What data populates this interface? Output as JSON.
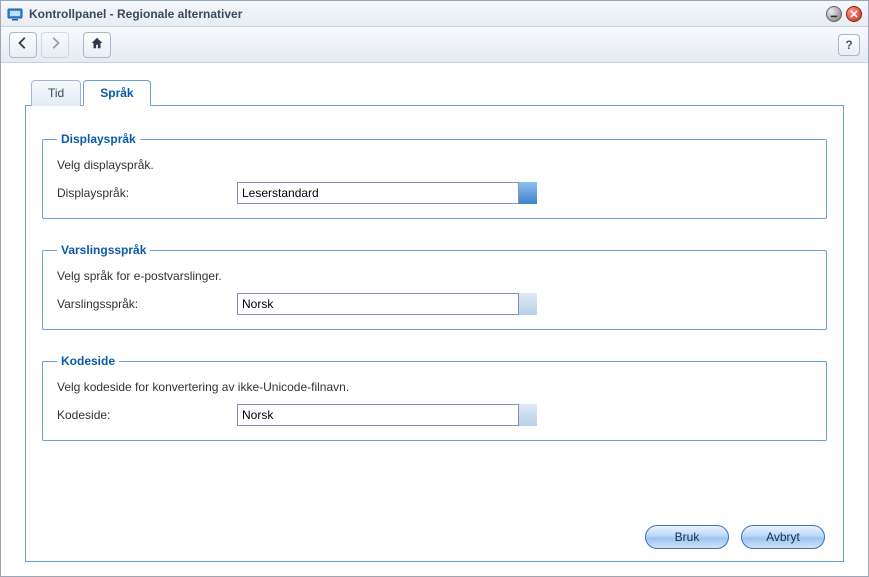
{
  "window": {
    "title": "Kontrollpanel - Regionale alternativer"
  },
  "toolbar": {
    "help_label": "?"
  },
  "tabs": {
    "time": "Tid",
    "language": "Språk"
  },
  "groups": {
    "display_language": {
      "legend": "Displayspråk",
      "desc": "Velg displayspråk.",
      "field_label": "Displayspråk:",
      "value": "Leserstandard"
    },
    "notification_language": {
      "legend": "Varslingsspråk",
      "desc": "Velg språk for e-postvarslinger.",
      "field_label": "Varslingsspråk:",
      "value": "Norsk"
    },
    "codepage": {
      "legend": "Kodeside",
      "desc": "Velg kodeside for konvertering av ikke-Unicode-filnavn.",
      "field_label": "Kodeside:",
      "value": "Norsk"
    }
  },
  "buttons": {
    "apply": "Bruk",
    "cancel": "Avbryt"
  }
}
